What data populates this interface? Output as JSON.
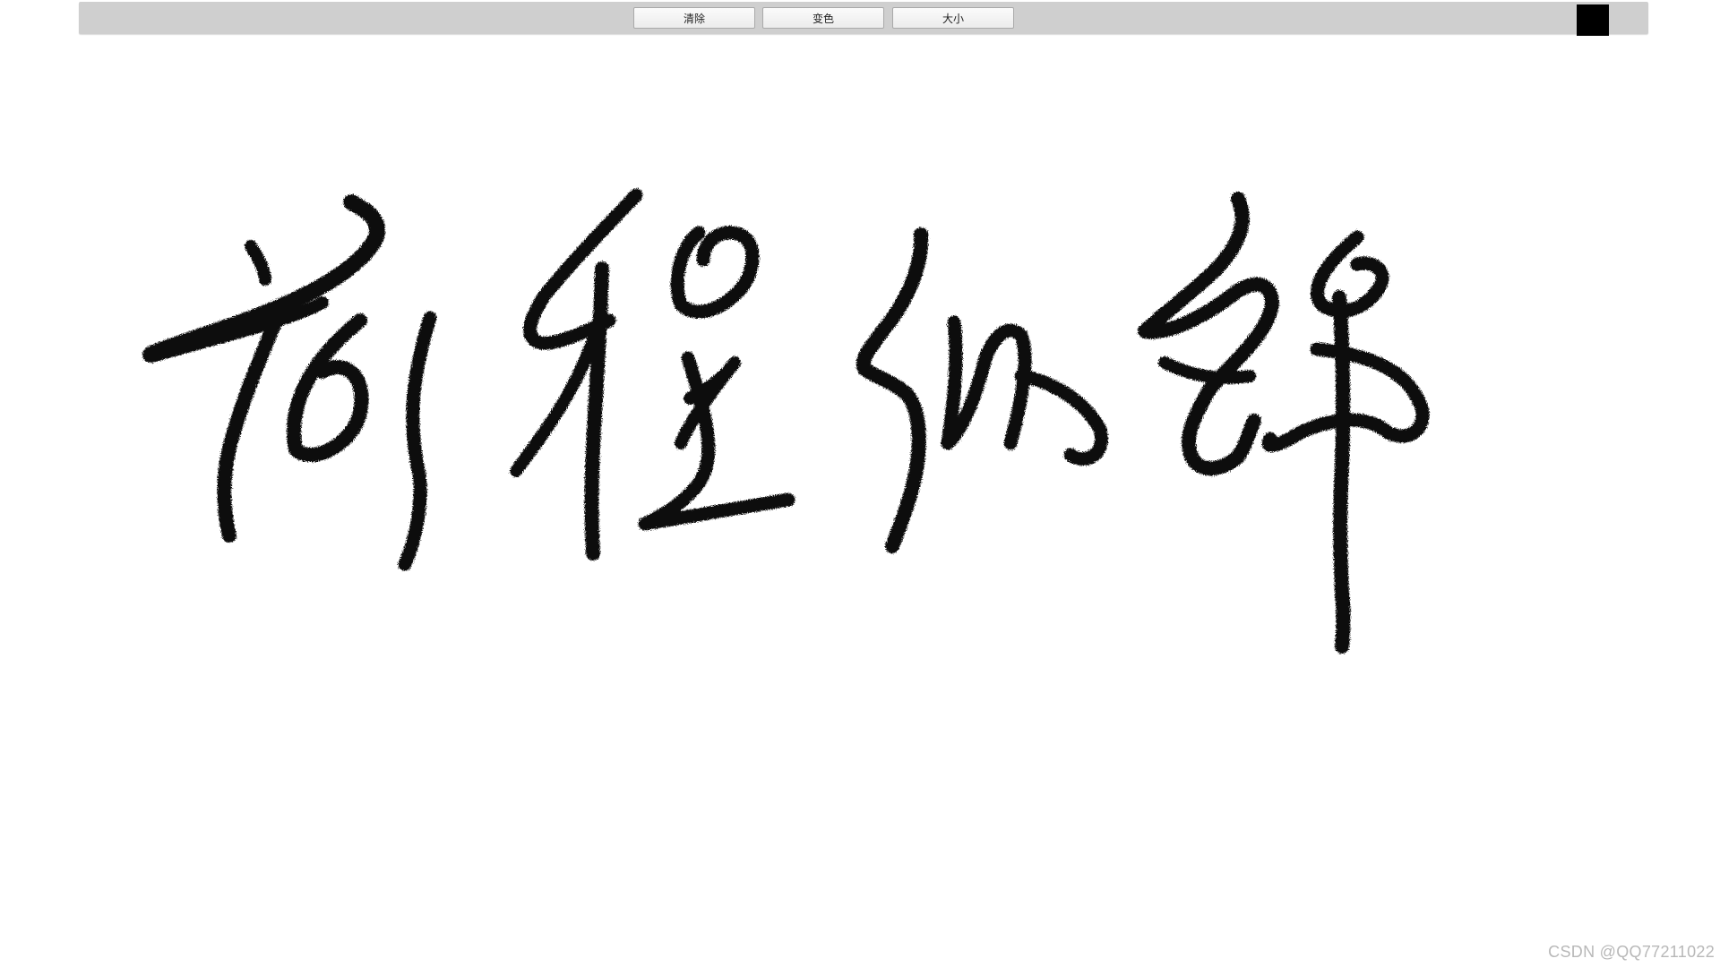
{
  "toolbar": {
    "clear_label": "清除",
    "color_label": "变色",
    "size_label": "大小",
    "brush_color": "#000000"
  },
  "canvas": {
    "handwriting_text": "前程似锦",
    "ink_color": "#0b0b0b"
  },
  "watermark": {
    "text": "CSDN @QQ77211022"
  }
}
